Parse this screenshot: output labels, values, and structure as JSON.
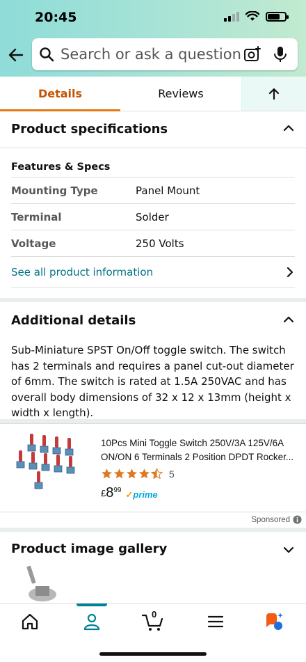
{
  "status": {
    "time": "20:45"
  },
  "search": {
    "placeholder": "Search or ask a question"
  },
  "tabs": {
    "details": "Details",
    "reviews": "Reviews"
  },
  "specs": {
    "title": "Product specifications",
    "group": "Features & Specs",
    "rows": [
      {
        "label": "Mounting Type",
        "value": "Panel Mount"
      },
      {
        "label": "Terminal",
        "value": "Solder"
      },
      {
        "label": "Voltage",
        "value": "250 Volts"
      }
    ],
    "see_all": "See all product information"
  },
  "additional": {
    "title": "Additional details",
    "text": "Sub-Miniature SPST On/Off toggle switch. The switch has 2 terminals and requires a panel cut-out diameter of 6mm. The switch is rated at 1.5A 250VAC and has overall body dimensions of 32 x 12 x 13mm (height x width x length)."
  },
  "ad": {
    "title": "10Pcs Mini Toggle Switch 250V/3A 125V/6A ON/ON 6 Terminals 2 Position DPDT Rocker...",
    "rating": 4.5,
    "rating_count": "5",
    "price_currency": "£",
    "price_main": "8",
    "price_fraction": "99",
    "prime_label": "prime",
    "sponsored": "Sponsored"
  },
  "gallery": {
    "title": "Product image gallery"
  },
  "colors": {
    "accent": "#e47911",
    "link": "#007185",
    "nav_active": "#008296",
    "star": "#de7921"
  },
  "icons": {
    "back": "arrow-left-icon",
    "search": "search-icon",
    "camera": "camera-icon",
    "mic": "mic-icon",
    "nav": [
      "home-icon",
      "account-icon",
      "cart-icon",
      "menu-icon",
      "rufus-ai-icon"
    ]
  },
  "cart_count": "0"
}
